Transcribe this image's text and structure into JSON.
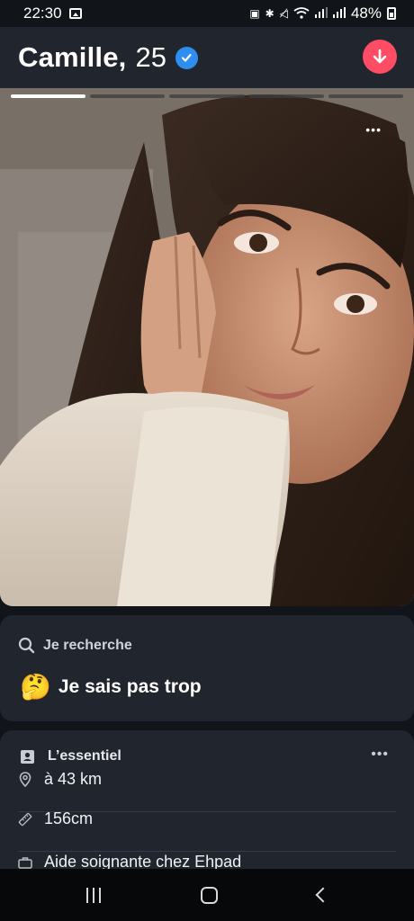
{
  "status_bar": {
    "time": "22:30",
    "battery": "48%",
    "icons": [
      "image-icon",
      "save-icon",
      "bluetooth-icon",
      "mute-icon",
      "wifi-icon",
      "signal-icon",
      "signal-icon",
      "battery-icon"
    ]
  },
  "header": {
    "name": "Camille,",
    "age": "25",
    "verified_icon": "check-badge-icon",
    "collapse_icon": "arrow-down-icon",
    "accent_color": "#fd4c63",
    "verified_color": "#2e8ef0"
  },
  "photo": {
    "segments_total": 5,
    "active_segment": 1,
    "more_icon": "more-horizontal-icon",
    "more_label": "•••"
  },
  "looking_for": {
    "label": "Je recherche",
    "icon": "search-icon",
    "emoji": "🤔",
    "value": "Je sais pas trop"
  },
  "essentials": {
    "title": "L’essentiel",
    "icon": "id-card-icon",
    "more_label": "•••",
    "rows": [
      {
        "icon": "location-pin-icon",
        "text": "à 43 km"
      },
      {
        "icon": "ruler-icon",
        "text": "156cm"
      },
      {
        "icon": "briefcase-icon",
        "text": "Aide soignante chez Ehpad"
      }
    ]
  },
  "nav": {
    "recents_icon": "recents-icon",
    "home_icon": "home-icon",
    "back_icon": "back-icon"
  }
}
